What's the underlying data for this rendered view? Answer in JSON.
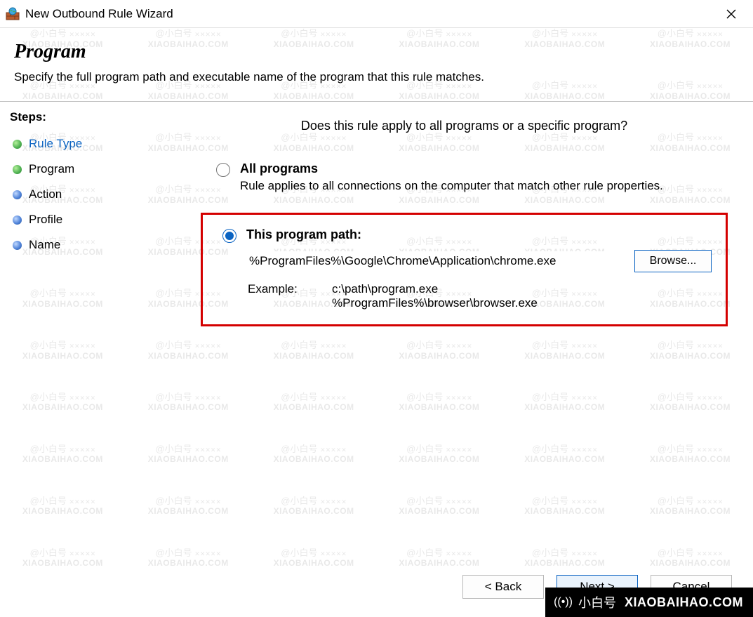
{
  "window": {
    "title": "New Outbound Rule Wizard"
  },
  "header": {
    "heading": "Program",
    "subtitle": "Specify the full program path and executable name of the program that this rule matches."
  },
  "sidebar": {
    "steps_label": "Steps:",
    "items": [
      {
        "label": "Rule Type",
        "state": "done"
      },
      {
        "label": "Program",
        "state": "done"
      },
      {
        "label": "Action",
        "state": "pending"
      },
      {
        "label": "Profile",
        "state": "pending"
      },
      {
        "label": "Name",
        "state": "pending"
      }
    ]
  },
  "main": {
    "question": "Does this rule apply to all programs or a specific program?",
    "option_all": {
      "title": "All programs",
      "desc": "Rule applies to all connections on the computer that match other rule properties."
    },
    "option_path": {
      "title": "This program path:",
      "value": "%ProgramFiles%\\Google\\Chrome\\Application\\chrome.exe",
      "browse_label": "Browse...",
      "example_label": "Example:",
      "example_line1": "c:\\path\\program.exe",
      "example_line2": "%ProgramFiles%\\browser\\browser.exe"
    }
  },
  "footer": {
    "back": "< Back",
    "next": "Next >",
    "cancel": "Cancel"
  },
  "watermark": {
    "line1": "@小白号",
    "line2": "XIAOBAIHAO.COM"
  },
  "badge": {
    "live_glyph": "((•))",
    "cn": "小白号",
    "en": "XIAOBAIHAO.COM"
  }
}
